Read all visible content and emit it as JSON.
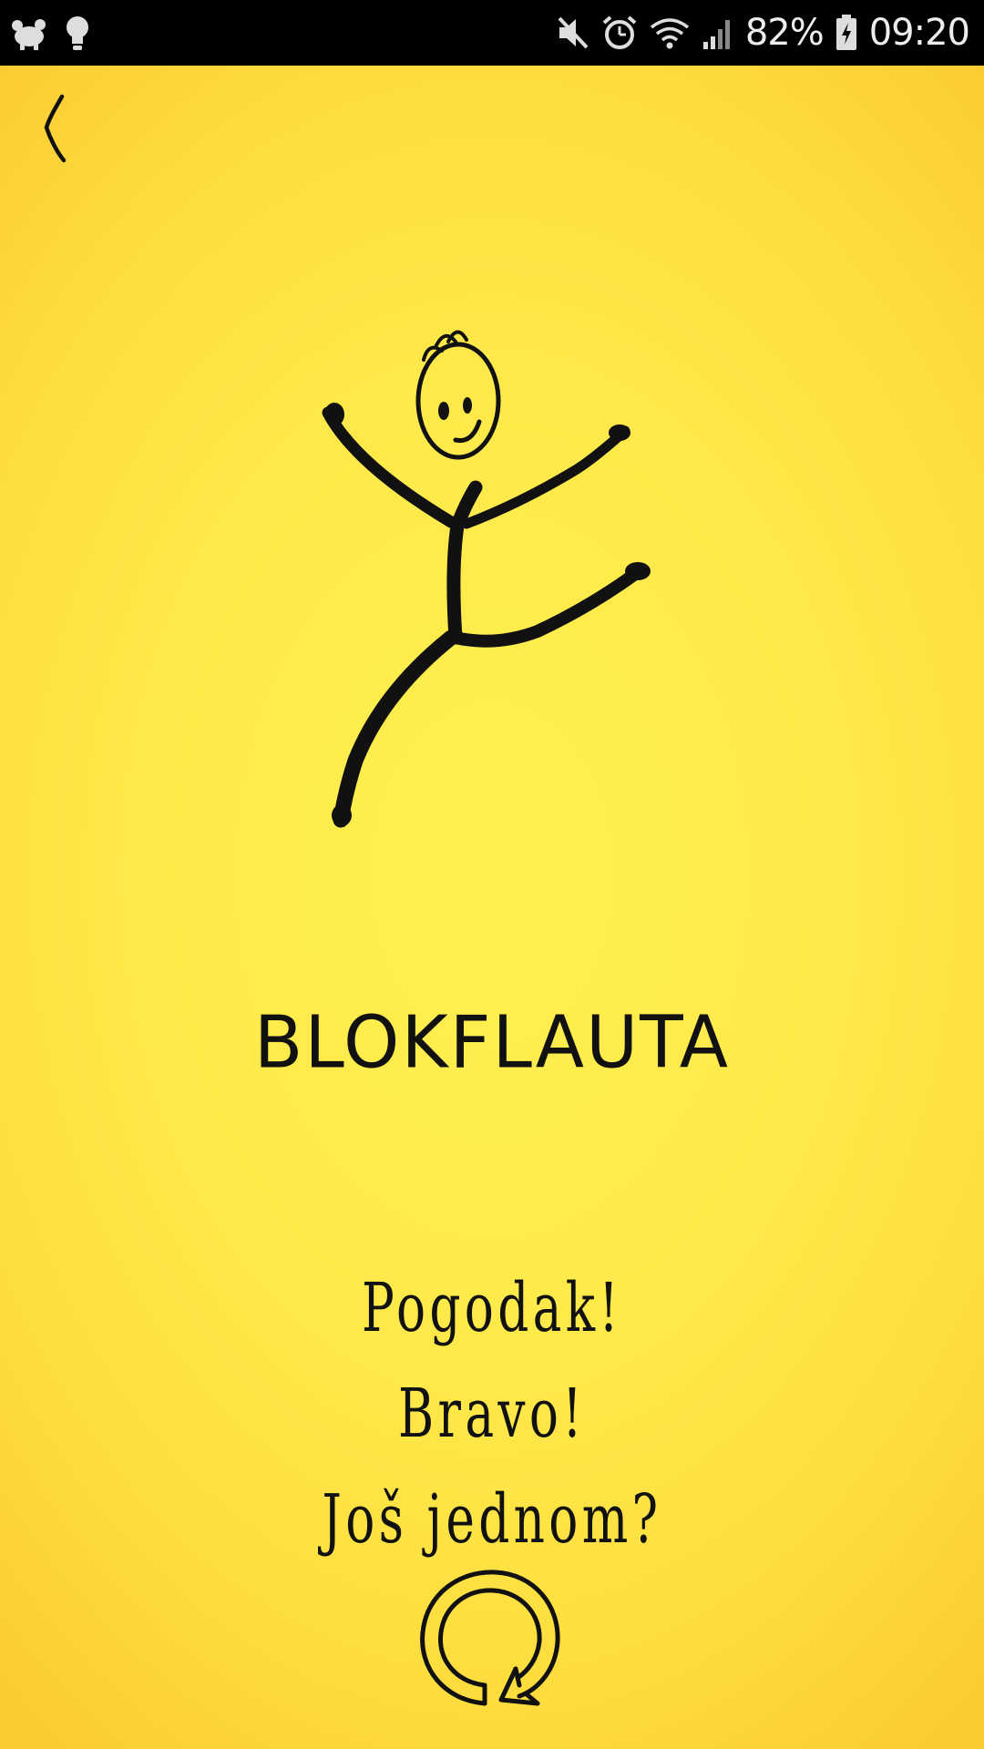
{
  "status_bar": {
    "battery_percent": "82%",
    "time": "09:20",
    "left_icons": [
      "notification-creature-icon",
      "lightbulb-icon"
    ],
    "right_icons": [
      "mute-icon",
      "alarm-icon",
      "wifi-icon",
      "signal-icon",
      "battery-charging-icon"
    ]
  },
  "game": {
    "word": "BLOKFLAUTA",
    "message_lines": [
      "Pogodak!",
      "Bravo!",
      "Još jednom?"
    ]
  },
  "icons": {
    "back": "back-chevron-icon",
    "replay": "replay-icon",
    "figure": "dancing-stick-figure"
  },
  "colors": {
    "background_center": "#fff050",
    "background_edge": "#fbca32",
    "ink": "#111111"
  }
}
